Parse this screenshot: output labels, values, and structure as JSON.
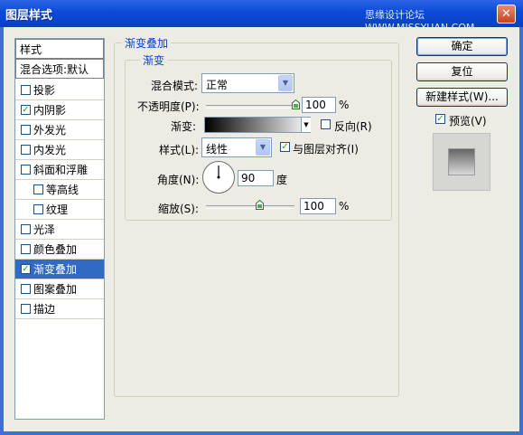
{
  "window": {
    "title": "图层样式",
    "watermark": "思缘设计论坛 WWW.MISSYUAN.COM",
    "close_glyph": "✕"
  },
  "styles_list": {
    "items": [
      {
        "label": "样式",
        "type": "header"
      },
      {
        "label": "混合选项:默认",
        "type": "header"
      },
      {
        "label": "投影",
        "checked": false
      },
      {
        "label": "内阴影",
        "checked": true
      },
      {
        "label": "外发光",
        "checked": false
      },
      {
        "label": "内发光",
        "checked": false
      },
      {
        "label": "斜面和浮雕",
        "checked": false
      },
      {
        "label": "等高线",
        "checked": false,
        "indent": true
      },
      {
        "label": "纹理",
        "checked": false,
        "indent": true
      },
      {
        "label": "光泽",
        "checked": false
      },
      {
        "label": "颜色叠加",
        "checked": false
      },
      {
        "label": "渐变叠加",
        "checked": true,
        "selected": true
      },
      {
        "label": "图案叠加",
        "checked": false
      },
      {
        "label": "描边",
        "checked": false
      }
    ]
  },
  "gradient_overlay": {
    "group_title": "渐变叠加",
    "subgroup_title": "渐变",
    "blend_mode_label": "混合模式:",
    "blend_mode_value": "正常",
    "opacity_label": "不透明度(P):",
    "opacity_value": "100",
    "opacity_fraction": 1.0,
    "percent": "%",
    "gradient_label": "渐变:",
    "reverse_label": "反向(R)",
    "reverse_checked": false,
    "style_label": "样式(L):",
    "style_value": "线性",
    "align_label": "与图层对齐(I)",
    "align_checked": true,
    "angle_label": "角度(N):",
    "angle_value": "90",
    "angle_unit": "度",
    "scale_label": "缩放(S):",
    "scale_value": "100",
    "scale_fraction": 0.6
  },
  "buttons": {
    "ok": "确定",
    "reset": "复位",
    "new_style": "新建样式(W)...",
    "preview_label": "预览(V)",
    "preview_checked": true
  },
  "icons": {
    "check": "✓",
    "dropdown": "▼"
  },
  "colors": {
    "accent": "#316ac5",
    "title_bar": "#0b4ad8",
    "group_title": "#0046d5"
  }
}
